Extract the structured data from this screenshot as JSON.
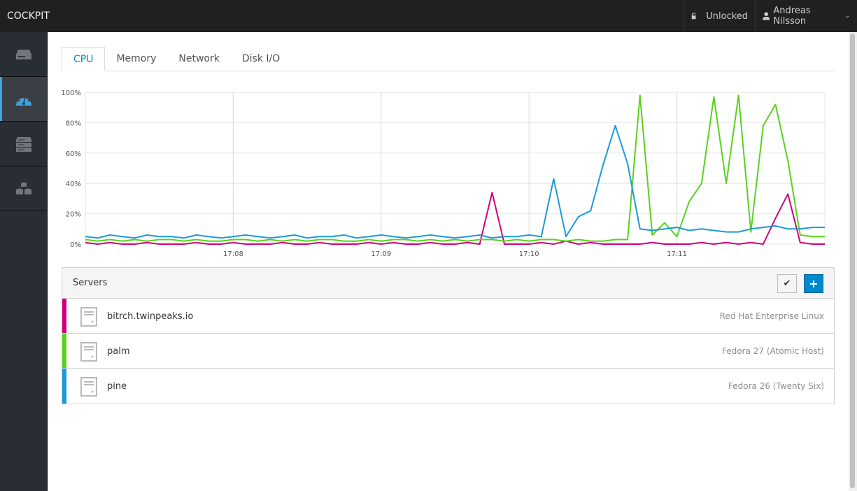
{
  "app": {
    "title": "COCKPIT",
    "lock_status": "Unlocked",
    "user": "Andreas Nilsson"
  },
  "sidebar": {
    "items": [
      {
        "icon": "server-icon"
      },
      {
        "icon": "dashboard-icon",
        "active": true
      },
      {
        "icon": "servers-stack-icon"
      },
      {
        "icon": "cluster-icon"
      }
    ]
  },
  "tabs": [
    {
      "label": "CPU",
      "active": true
    },
    {
      "label": "Memory"
    },
    {
      "label": "Network"
    },
    {
      "label": "Disk I/O"
    }
  ],
  "chart_data": {
    "type": "line",
    "yticks": [
      "0%",
      "20%",
      "40%",
      "60%",
      "80%",
      "100%"
    ],
    "ylim": [
      0,
      100
    ],
    "xticks": [
      "17:08",
      "17:09",
      "17:10",
      "17:11"
    ],
    "xrange": [
      "17:07:00",
      "17:12:00"
    ],
    "sample_interval_seconds": 5,
    "grid": true,
    "series": [
      {
        "name": "bitrch.twinpeaks.io",
        "color": "#d1007e",
        "values": [
          1,
          0,
          1,
          0,
          0,
          1,
          0,
          0,
          0,
          1,
          0,
          0,
          1,
          0,
          0,
          0,
          1,
          0,
          0,
          1,
          0,
          0,
          0,
          1,
          0,
          1,
          0,
          0,
          1,
          0,
          0,
          1,
          0,
          34,
          0,
          0,
          0,
          1,
          0,
          2,
          0,
          1,
          0,
          0,
          0,
          0,
          1,
          0,
          0,
          0,
          1,
          0,
          1,
          0,
          1,
          0,
          17,
          33,
          1,
          0,
          0
        ]
      },
      {
        "name": "palm",
        "color": "#59d21d",
        "values": [
          3,
          2,
          3,
          2,
          3,
          2,
          3,
          3,
          2,
          3,
          2,
          2,
          3,
          3,
          2,
          3,
          2,
          3,
          2,
          3,
          3,
          2,
          2,
          3,
          2,
          3,
          3,
          2,
          3,
          2,
          3,
          2,
          3,
          3,
          2,
          3,
          2,
          3,
          3,
          2,
          3,
          2,
          2,
          3,
          3,
          98,
          6,
          14,
          5,
          28,
          40,
          97,
          40,
          98,
          8,
          78,
          92,
          55,
          6,
          5,
          5
        ]
      },
      {
        "name": "pine",
        "color": "#1b9ad6",
        "values": [
          5,
          4,
          6,
          5,
          4,
          6,
          5,
          5,
          4,
          6,
          5,
          4,
          5,
          6,
          5,
          4,
          5,
          6,
          4,
          5,
          5,
          6,
          4,
          5,
          6,
          5,
          4,
          5,
          6,
          5,
          4,
          5,
          6,
          4,
          5,
          5,
          6,
          5,
          43,
          5,
          18,
          22,
          52,
          78,
          53,
          10,
          9,
          10,
          11,
          9,
          10,
          9,
          8,
          8,
          10,
          11,
          12,
          10,
          10,
          11,
          11
        ]
      }
    ]
  },
  "servers": {
    "title": "Servers",
    "edit_icon": "checkmark-icon",
    "add_icon": "plus-icon",
    "items": [
      {
        "name": "bitrch.twinpeaks.io",
        "os": "Red Hat Enterprise Linux",
        "color": "#d1007e"
      },
      {
        "name": "palm",
        "os": "Fedora 27 (Atomic Host)",
        "color": "#59d21d"
      },
      {
        "name": "pine",
        "os": "Fedora 26 (Twenty Six)",
        "color": "#1b9ad6"
      }
    ]
  }
}
